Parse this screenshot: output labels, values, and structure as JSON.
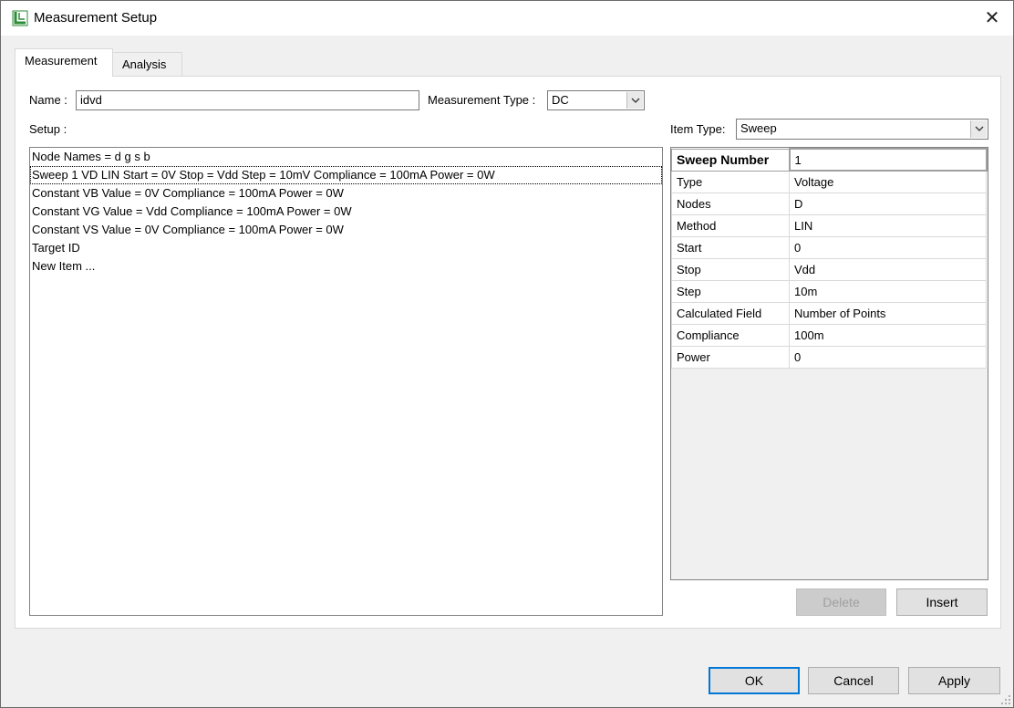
{
  "window": {
    "title": "Measurement Setup"
  },
  "tabs": [
    {
      "label": "Measurement"
    },
    {
      "label": "Analysis"
    }
  ],
  "form": {
    "name_label": "Name :",
    "name_value": "idvd",
    "measurement_type_label": "Measurement Type :",
    "measurement_type_value": "DC",
    "setup_label": "Setup :",
    "item_type_label": "Item Type:",
    "item_type_value": "Sweep"
  },
  "setup_items": [
    "Node Names = d g s b",
    "Sweep 1 VD LIN Start = 0V Stop = Vdd Step = 10mV Compliance = 100mA Power = 0W",
    "Constant VB Value = 0V Compliance = 100mA Power = 0W",
    "Constant VG Value = Vdd Compliance = 100mA Power = 0W",
    "Constant VS Value = 0V Compliance = 100mA Power = 0W",
    "Target ID",
    "New Item ..."
  ],
  "properties": [
    {
      "key": "Sweep Number",
      "value": "1"
    },
    {
      "key": "Type",
      "value": "Voltage"
    },
    {
      "key": "Nodes",
      "value": "D"
    },
    {
      "key": "Method",
      "value": "LIN"
    },
    {
      "key": "Start",
      "value": "0"
    },
    {
      "key": "Stop",
      "value": "Vdd"
    },
    {
      "key": "Step",
      "value": "10m"
    },
    {
      "key": "Calculated Field",
      "value": "Number of Points"
    },
    {
      "key": "Compliance",
      "value": "100m"
    },
    {
      "key": "Power",
      "value": "0"
    }
  ],
  "buttons": {
    "delete": "Delete",
    "insert": "Insert",
    "ok": "OK",
    "cancel": "Cancel",
    "apply": "Apply"
  },
  "colors": {
    "accent": "#0078d7",
    "app_icon": "#2e8b3a"
  }
}
